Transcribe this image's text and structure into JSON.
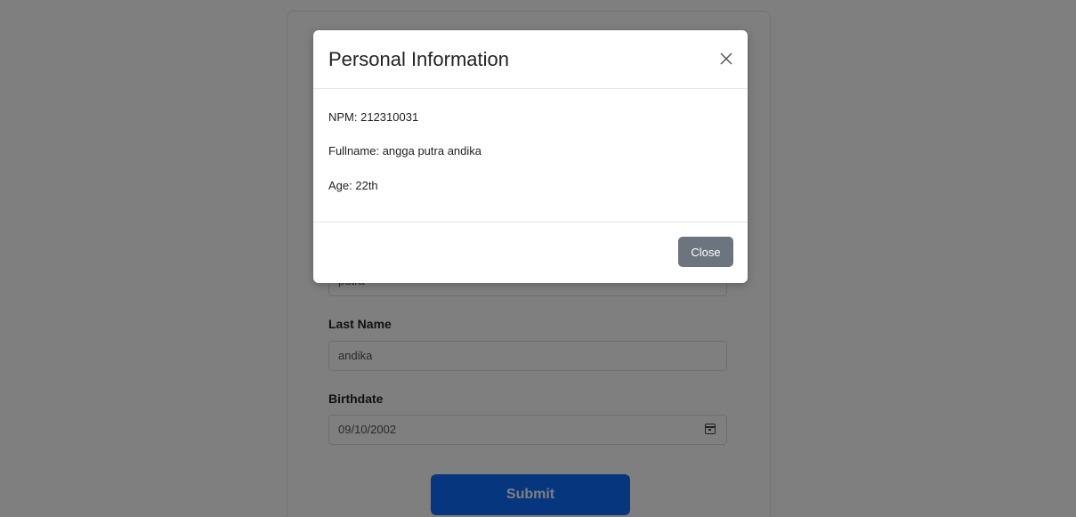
{
  "modal": {
    "title": "Personal Information",
    "npm": "NPM: 212310031",
    "fullname": "Fullname: angga putra andika",
    "age": "Age: 22th",
    "close_label": "Close"
  },
  "form": {
    "middle_name_value": "putra",
    "last_name_label": "Last Name",
    "last_name_value": "andika",
    "birthdate_label": "Birthdate",
    "birthdate_value": "09/10/2002",
    "submit_label": "Submit"
  },
  "colors": {
    "primary": "#0d6efd",
    "secondary": "#6c757d",
    "backdrop": "rgba(0,0,0,0.5)"
  },
  "icons": [
    "close-icon",
    "calendar-icon"
  ]
}
